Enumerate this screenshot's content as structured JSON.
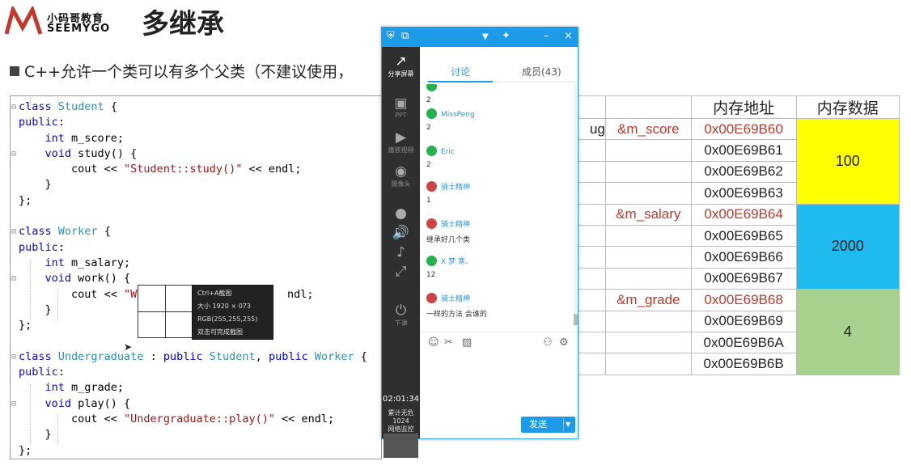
{
  "header": {
    "logo_cn": "小码哥教育",
    "logo_en": "SEEMYGO",
    "title": "多继承",
    "bullet": "C++允许一个类可以有多个父类（不建议使用，"
  },
  "code_lines": [
    "class Student {",
    "public:",
    "    int m_score;",
    "    void study() {",
    "        cout << \"Student::study()\" << endl;",
    "    }",
    "};",
    "",
    "class Worker {",
    "public:",
    "    int m_salary;",
    "    void work() {",
    "        cout << \"W",
    "    }",
    "};",
    "",
    "class Undergraduate : public Student, public Worker {",
    "public:",
    "    int m_grade;",
    "    void play() {",
    "        cout << \"Undergraduate::play()\" << endl;",
    "    }",
    "};"
  ],
  "code_fragment_after_tip": "ndl;",
  "tooltip": {
    "line1": "Ctrl+A截图",
    "line2": "大小 1920 × 073",
    "line3": "RGB(255,255,255)",
    "line4": "双击可完成截图"
  },
  "chat": {
    "tab_discuss": "讨论",
    "tab_members": "成员(43)",
    "side_items": [
      {
        "icon": "share-screen-icon",
        "glyph": "↗",
        "label": "分享屏幕"
      },
      {
        "icon": "ppt-icon",
        "glyph": "▣",
        "label": "PPT"
      },
      {
        "icon": "video-play-icon",
        "glyph": "▶",
        "label": "播放视频"
      },
      {
        "icon": "camera-icon",
        "glyph": "◉",
        "label": "摄像头"
      },
      {
        "icon": "mic-icon",
        "glyph": "●",
        "label": ""
      },
      {
        "icon": "speaker-icon",
        "glyph": "🔊",
        "label": ""
      },
      {
        "icon": "music-icon",
        "glyph": "♪",
        "label": ""
      },
      {
        "icon": "expand-icon",
        "glyph": "⤢",
        "label": ""
      },
      {
        "icon": "power-icon",
        "glyph": "⏻",
        "label": "下课"
      }
    ],
    "clock": "02:01:34",
    "stat_label": "累计无危",
    "stat_value": "1024",
    "stat_net": "网络监控",
    "messages": [
      {
        "name": "",
        "text": "2",
        "avatar": "wechat"
      },
      {
        "name": "MissPeng",
        "text": "2",
        "avatar": "wechat"
      },
      {
        "name": "Eric",
        "text": "2",
        "avatar": "wechat"
      },
      {
        "name": "骑士精神",
        "text": "1",
        "avatar": "user"
      },
      {
        "name": "骑士精神",
        "text": "继承好几个类",
        "avatar": "user"
      },
      {
        "name": "X 梦 寒、",
        "text": "12",
        "avatar": "wechat"
      },
      {
        "name": "骑士精神",
        "text": "一样的方法 会谁的",
        "avatar": "user"
      }
    ],
    "send_label": "发送"
  },
  "memory_table": {
    "headers": [
      "内存地址",
      "内存数据"
    ],
    "rows": [
      {
        "label": "ug",
        "var": "&m_score",
        "addr": "0x00E69B60"
      },
      {
        "label": "",
        "var": "",
        "addr": "0x00E69B61"
      },
      {
        "label": "",
        "var": "",
        "addr": "0x00E69B62"
      },
      {
        "label": "",
        "var": "",
        "addr": "0x00E69B63"
      },
      {
        "label": "",
        "var": "&m_salary",
        "addr": "0x00E69B64"
      },
      {
        "label": "",
        "var": "",
        "addr": "0x00E69B65"
      },
      {
        "label": "",
        "var": "",
        "addr": "0x00E69B66"
      },
      {
        "label": "",
        "var": "",
        "addr": "0x00E69B67"
      },
      {
        "label": "",
        "var": "&m_grade",
        "addr": "0x00E69B68"
      },
      {
        "label": "",
        "var": "",
        "addr": "0x00E69B69"
      },
      {
        "label": "",
        "var": "",
        "addr": "0x00E69B6A"
      },
      {
        "label": "",
        "var": "",
        "addr": "0x00E69B6B"
      }
    ],
    "values": [
      {
        "value": "100",
        "color": "#ffff00"
      },
      {
        "value": "2000",
        "color": "#1fbbee"
      },
      {
        "value": "4",
        "color": "#a9d18e"
      }
    ],
    "highlight_color": "#c0392b"
  }
}
